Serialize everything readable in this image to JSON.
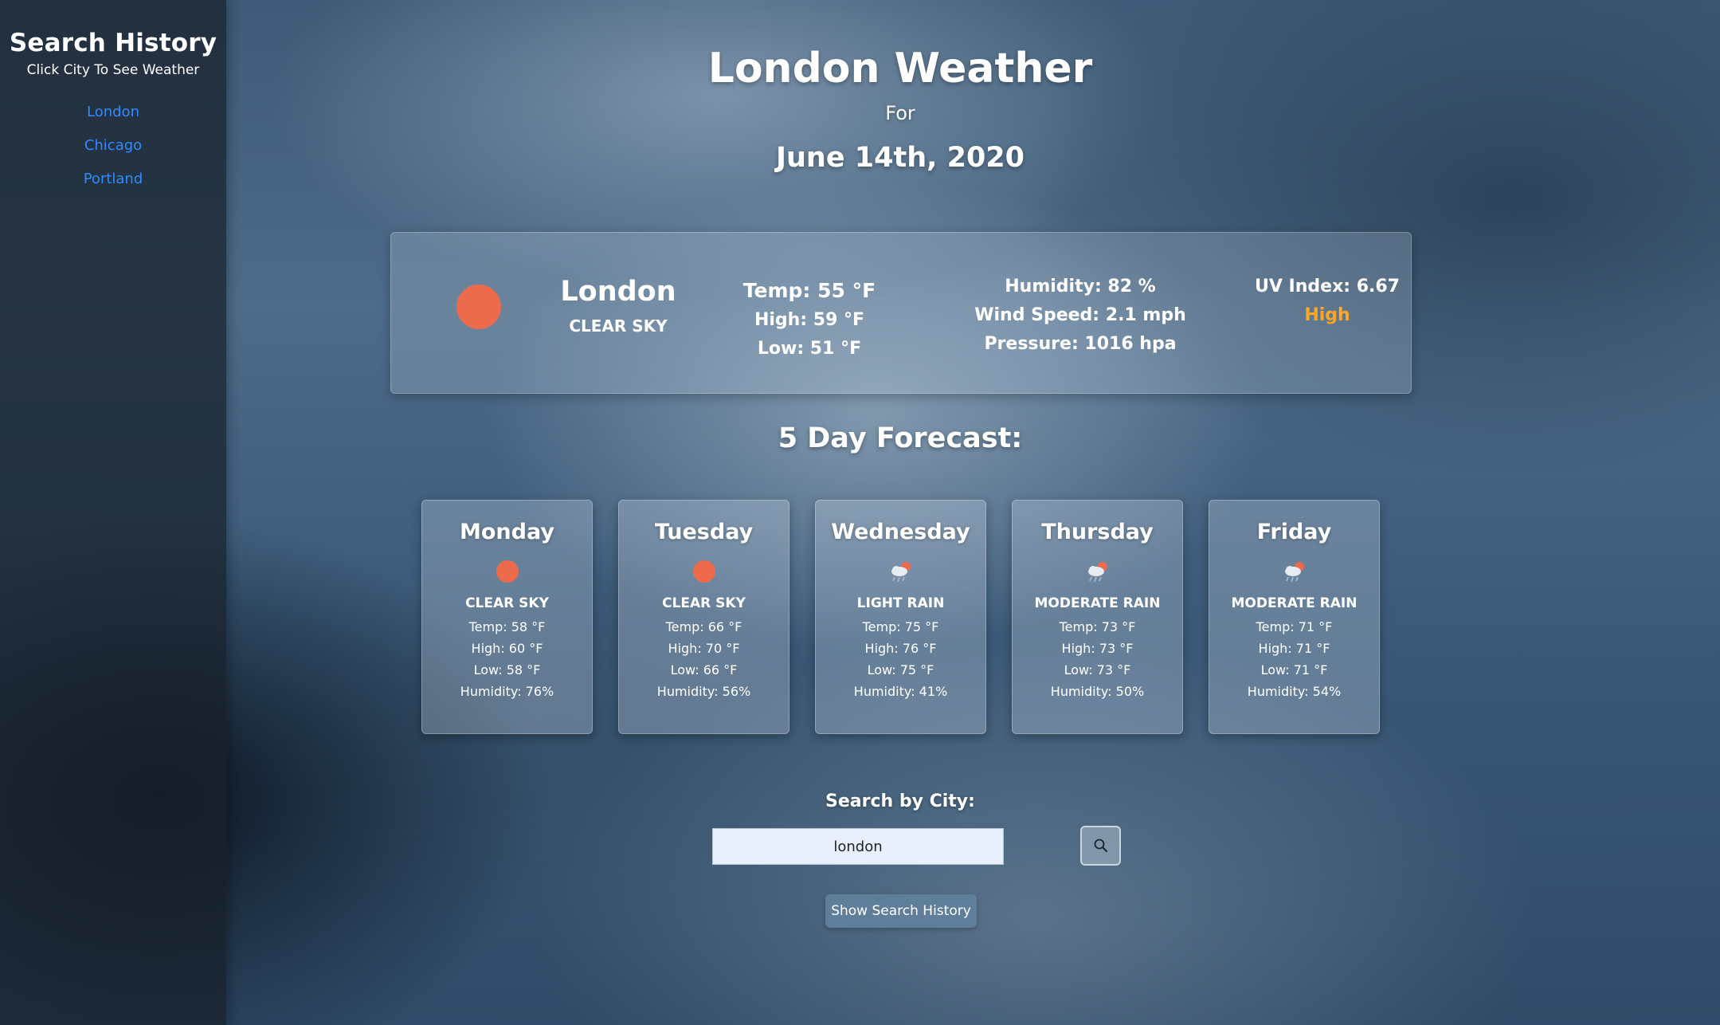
{
  "sidebar": {
    "title": "Search History",
    "subtitle": "Click City To See Weather",
    "items": [
      {
        "label": "London"
      },
      {
        "label": "Chicago"
      },
      {
        "label": "Portland"
      }
    ]
  },
  "header": {
    "title": "London Weather",
    "for_label": "For",
    "date": "June 14th, 2020"
  },
  "current": {
    "icon": "sun-icon",
    "city": "London",
    "description": "CLEAR SKY",
    "temp": "Temp: 55 °F",
    "high": "High: 59 °F",
    "low": "Low: 51 °F",
    "humidity": "Humidity: 82 %",
    "wind": "Wind Speed: 2.1 mph",
    "pressure": "Pressure: 1016 hpa",
    "uv_index": "UV Index: 6.67",
    "uv_level": "High",
    "uv_level_color": "#ffa726"
  },
  "forecast": {
    "title": "5 Day Forecast:",
    "days": [
      {
        "day": "Monday",
        "icon": "sun-icon",
        "description": "CLEAR SKY",
        "temp": "Temp: 58 °F",
        "high": "High: 60 °F",
        "low": "Low: 58 °F",
        "humidity": "Humidity: 76%"
      },
      {
        "day": "Tuesday",
        "icon": "sun-icon",
        "description": "CLEAR SKY",
        "temp": "Temp: 66 °F",
        "high": "High: 70 °F",
        "low": "Low: 66 °F",
        "humidity": "Humidity: 56%"
      },
      {
        "day": "Wednesday",
        "icon": "rain-cloud-icon",
        "description": "LIGHT RAIN",
        "temp": "Temp: 75 °F",
        "high": "High: 76 °F",
        "low": "Low: 75 °F",
        "humidity": "Humidity: 41%"
      },
      {
        "day": "Thursday",
        "icon": "rain-cloud-icon",
        "description": "MODERATE RAIN",
        "temp": "Temp: 73 °F",
        "high": "High: 73 °F",
        "low": "Low: 73 °F",
        "humidity": "Humidity: 50%"
      },
      {
        "day": "Friday",
        "icon": "rain-cloud-icon",
        "description": "MODERATE RAIN",
        "temp": "Temp: 71 °F",
        "high": "High: 71 °F",
        "low": "Low: 71 °F",
        "humidity": "Humidity: 54%"
      }
    ]
  },
  "search": {
    "label": "Search by City:",
    "value": "london",
    "button_icon": "search-icon",
    "history_button": "Show Search History"
  },
  "colors": {
    "accent_link": "#2f8bff",
    "sun": "#ee6a4c",
    "uv_high": "#ffa726"
  }
}
